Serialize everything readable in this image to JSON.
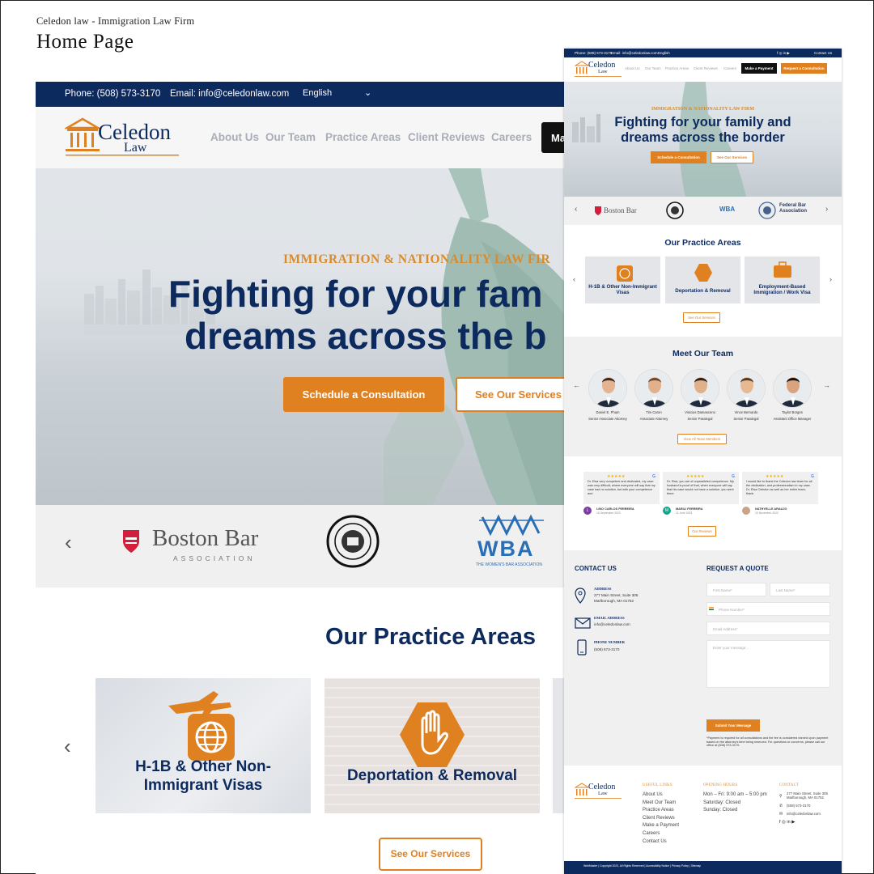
{
  "caption": {
    "subtitle": "Celedon law - Immigration Law Firm",
    "title": "Home Page"
  },
  "colors": {
    "navy": "#0d2a5e",
    "orange": "#e08121",
    "gray_bg": "#f0f0f0"
  },
  "site": {
    "topbar": {
      "phone": "Phone: (508) 573-3170",
      "email": "Email: info@celedonlaw.com",
      "language": "English",
      "short_phone": "Phone: (508) 573-3170",
      "short_email": "Email: info@celedonlaw.com",
      "contact_link": "Contact Us"
    },
    "logo": {
      "name": "Celedon",
      "sub": "Law"
    },
    "nav": [
      "About Us",
      "Our Team",
      "Practice Areas",
      "Client Reviews",
      "Careers"
    ],
    "make_payment_partial": "Ma",
    "make_payment": "Make a Payment",
    "request_quote": "Request a Consultation",
    "hero": {
      "eyebrow": "IMMIGRATION & NATIONALITY LAW FIRM",
      "eyebrow_cropped": "IMMIGRATION & NATIONALITY LAW FIR",
      "headline_line1_cropped": "Fighting for your fam",
      "headline_line2_cropped": "dreams across the b",
      "headline": "Fighting for your family and dreams across the border",
      "btn_primary": "Schedule a Consultation",
      "btn_secondary": "See Our Services"
    },
    "associations": {
      "boston_bar": "Boston Bar",
      "boston_bar_sub": "ASSOCIATION",
      "wba": "WBA",
      "wba_sub": "THE WOMEN'S BAR ASSOCIATION",
      "federal_bar": "Federal Bar Association"
    },
    "practice": {
      "title": "Our Practice Areas",
      "cards": [
        {
          "label": "H-1B & Other Non-Immigrant Visas",
          "line1": "H-1B & Other Non-",
          "line2": "Immigrant Visas"
        },
        {
          "label": "Deportation & Removal"
        },
        {
          "label": "Employment-Based Immigration / Work Visa",
          "line1": "Employment-Based",
          "line2": "Immigration / Work Visa"
        }
      ],
      "button": "See Our Services"
    },
    "team": {
      "title": "Meet Our Team",
      "members": [
        {
          "name": "Daniel E. Pham",
          "role": "Senior Associate Attorney"
        },
        {
          "name": "Tim Caron",
          "role": "Associate Attorney"
        },
        {
          "name": "Vinicius Damasceno",
          "role": "Senior Paralegal"
        },
        {
          "name": "Vince Bernardo",
          "role": "Senior Paralegal"
        },
        {
          "name": "Taylor Borges",
          "role": "Assistant Office Manager"
        }
      ],
      "button": "View All Team Members"
    },
    "reviews": {
      "stars": "★★★★★",
      "google": "G",
      "items": [
        {
          "text": "Dr. Elsa very competent and dedicated, my case was very difficult, where everyone will say that my case had no solution, but with your competence and",
          "name": "LINO CARLOS FERREIRA",
          "date": "15 September 2023",
          "initial": "L"
        },
        {
          "text": "Dr. Elsa, you are of unparalleled competence. My husband is proof of that, when everyone will say that his case would not have a solution, you went there",
          "name": "MARILI FERREIRA",
          "date": "11 June 2023",
          "initial": "M"
        },
        {
          "text": "I would like to thank the Celedon law team for all the dedication, and professionalism in my case. Dr. Elsa Celedon as well as her entire team, thank",
          "name": "NATHYELLE ARAUJO",
          "date": "10 November 2022",
          "initial": ""
        }
      ],
      "button": "Our Reviews"
    },
    "contact": {
      "title": "CONTACT US",
      "address_label": "ADDRESS",
      "address_line1": "277 Main Street, Suite 305",
      "address_line2": "Marlborough, MA 01752",
      "email_label": "EMAIL ADDRESS",
      "email": "info@celedonlaw.com",
      "phone_label": "PHONE NUMBER",
      "phone": "(508) 573-3170"
    },
    "quote": {
      "title": "REQUEST A QUOTE",
      "first_name": "First Name*",
      "last_name": "Last Name*",
      "phone": "Phone Number*",
      "email": "Email Address*",
      "message": "Enter your message...",
      "submit": "Submit Your Message",
      "note": "*Payment is required for all consultations and the fee is considered earned upon payment based on the attorney's time being reserved. For questions or concerns, please call our office at (508) 573-3170."
    },
    "footer": {
      "useful_links_title": "USEFUL LINKS",
      "useful_links": [
        "About Us",
        "Meet Our Team",
        "Practice Areas",
        "Client Reviews",
        "Make a Payment",
        "Careers",
        "Contact Us"
      ],
      "hours_title": "OPENING HOURS",
      "hours": [
        "Mon – Fri: 9:00 am – 5:00 pm",
        "Saturday: Closed",
        "Sunday: Closed"
      ],
      "contact_title": "CONTACT",
      "contact_address": "277 Main Street, Suite 305 Marlborough, MA 01752",
      "contact_phone": "(508) 573-3170",
      "contact_email": "info@celedonlaw.com",
      "bottom": "WebMaster  |  Copyright 2023, All Rights Reserved  |  Accessibility Notice  |  Privacy Policy  |  Sitemap"
    }
  }
}
